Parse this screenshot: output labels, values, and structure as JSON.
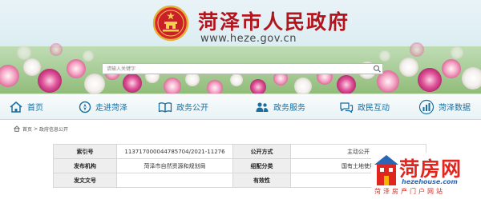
{
  "header": {
    "site_title": "菏泽市人民政府",
    "site_url": "www.heze.gov.cn",
    "search_placeholder": "请输入关键字"
  },
  "nav": {
    "items": [
      {
        "label": "首页",
        "icon": "home-icon"
      },
      {
        "label": "走进菏泽",
        "icon": "compass-icon"
      },
      {
        "label": "政务公开",
        "icon": "book-icon"
      },
      {
        "label": "政务服务",
        "icon": "people-icon"
      },
      {
        "label": "政民互动",
        "icon": "chat-icon"
      },
      {
        "label": "菏泽数据",
        "icon": "chart-icon"
      }
    ]
  },
  "breadcrumb": {
    "home": "首页",
    "separator": ">",
    "current": "政府信息公开"
  },
  "info_table": {
    "rows": [
      {
        "label1": "索引号",
        "value1": "113717000044785704/2021-11276",
        "label2": "公开方式",
        "value2": "主动公开"
      },
      {
        "label1": "发布机构",
        "value1": "菏泽市自然资源和规划局",
        "label2": "组配分类",
        "value2": "国有土地使用"
      },
      {
        "label1": "发文文号",
        "value1": "",
        "label2": "有效性",
        "value2": ""
      }
    ]
  },
  "watermark": {
    "name": "菏房网",
    "domain": "hezehouse.com",
    "tagline": "菏泽房产门户网站"
  },
  "colors": {
    "title_red": "#b4141c",
    "nav_blue": "#1a6fa0",
    "watermark_red": "#e0261f",
    "watermark_blue": "#2a66b5"
  }
}
